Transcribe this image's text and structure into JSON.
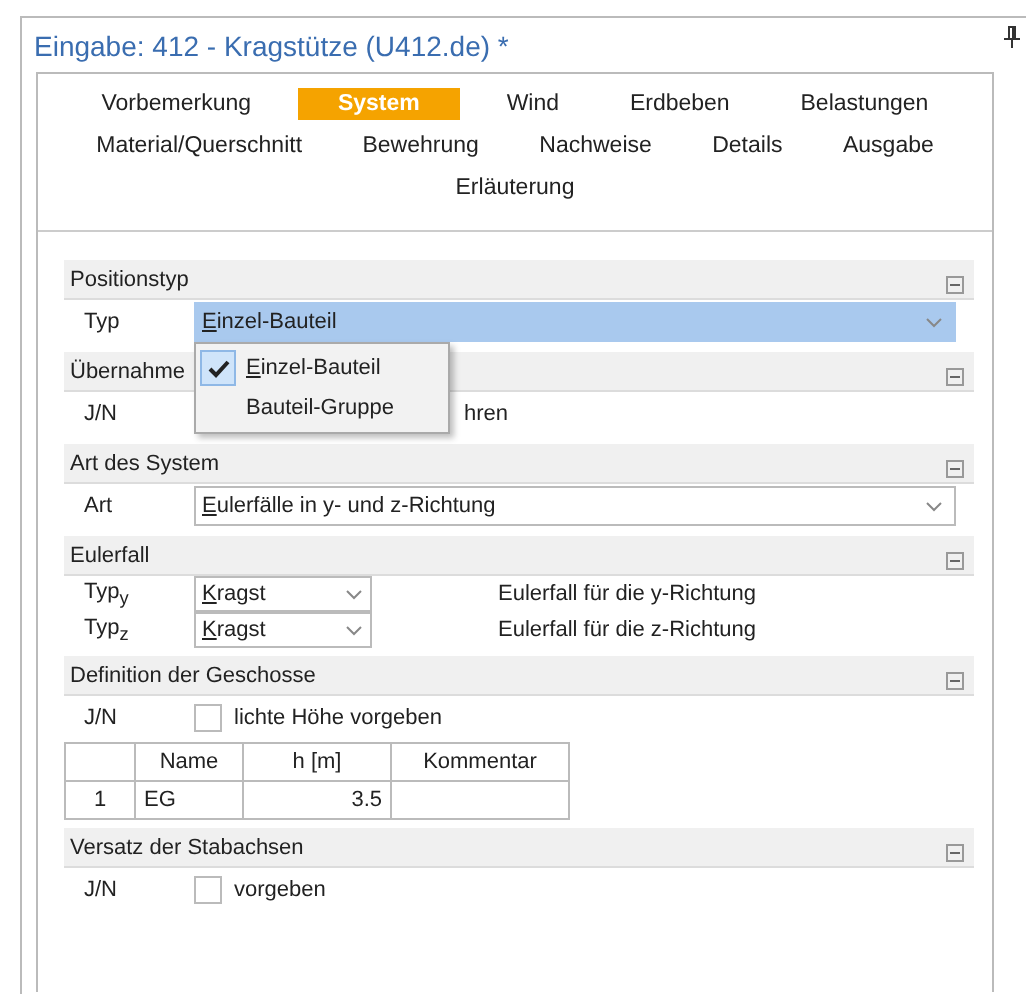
{
  "window": {
    "title": "Eingabe: 412 - Kragstütze (U412.de) *"
  },
  "tab_rows": [
    [
      {
        "label": "Vorbemerkung",
        "selected": false
      },
      {
        "label": "System",
        "selected": true
      },
      {
        "label": "Wind",
        "selected": false
      },
      {
        "label": "Erdbeben",
        "selected": false
      },
      {
        "label": "Belastungen",
        "selected": false
      }
    ],
    [
      {
        "label": "Material/Querschnitt",
        "selected": false
      },
      {
        "label": "Bewehrung",
        "selected": false
      },
      {
        "label": "Nachweise",
        "selected": false
      },
      {
        "label": "Details",
        "selected": false
      },
      {
        "label": "Ausgabe",
        "selected": false
      }
    ],
    [
      {
        "label": "Erläuterung",
        "selected": false
      }
    ]
  ],
  "sections": [
    {
      "title": "Positionstyp",
      "expanded": true,
      "rows": [
        {
          "kind": "combo",
          "label": "Typ",
          "value": "Einzel-Bauteil",
          "focused": true,
          "dropdown": [
            {
              "label": "Einzel-Bauteil",
              "selected": true
            },
            {
              "label": "Bauteil-Gruppe",
              "selected": false
            }
          ]
        }
      ]
    },
    {
      "title": "Übernahme",
      "expanded": true,
      "rows": [
        {
          "kind": "covered",
          "label": "J/N",
          "text": "hren"
        }
      ]
    },
    {
      "title": "Art des System",
      "expanded": true,
      "rows": [
        {
          "kind": "combo",
          "label": "Art",
          "value": "Eulerfälle in y- und z-Richtung",
          "focused": false
        }
      ]
    },
    {
      "title": "Eulerfall",
      "expanded": true,
      "rows": [
        {
          "kind": "small_combo",
          "label": "Typ$_{y}$",
          "value": "Kragst",
          "note": "Eulerfall für die y-Richtung"
        },
        {
          "kind": "small_combo",
          "label": "Typ$_{z}$",
          "value": "Kragst",
          "note": "Eulerfall für die z-Richtung"
        }
      ]
    },
    {
      "title": "Definition der Geschosse",
      "expanded": true,
      "rows": [
        {
          "kind": "checkbox",
          "label": "J/N",
          "text": "lichte Höhe vorgeben",
          "checked": false
        },
        {
          "kind": "table",
          "columns": [
            "Name",
            "h [m]",
            "Kommentar"
          ],
          "rows": [
            {
              "index": "1",
              "cells": [
                "EG",
                "3.5"
              ]
            }
          ]
        }
      ]
    },
    {
      "title": "Versatz der Stabachsen",
      "expanded": true,
      "rows": [
        {
          "kind": "checkbox",
          "label": "J/N",
          "text": "vorgeben",
          "checked": false
        }
      ]
    }
  ]
}
